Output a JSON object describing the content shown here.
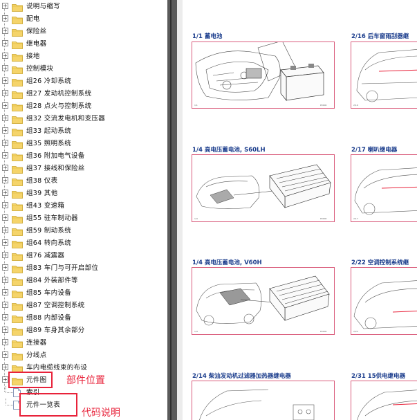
{
  "tree": {
    "items": [
      {
        "label": "说明与缩写",
        "expand": true
      },
      {
        "label": "配电",
        "expand": true
      },
      {
        "label": "保险丝",
        "expand": true
      },
      {
        "label": "继电器",
        "expand": true
      },
      {
        "label": "接地",
        "expand": true
      },
      {
        "label": "控制模块",
        "expand": true
      },
      {
        "label": "组26 冷却系统",
        "expand": true
      },
      {
        "label": "组27 发动机控制系统",
        "expand": true
      },
      {
        "label": "组28 点火与控制系统",
        "expand": true
      },
      {
        "label": "组32 交流发电机和变压器",
        "expand": true
      },
      {
        "label": "组33 起动系统",
        "expand": true
      },
      {
        "label": "组35 照明系统",
        "expand": true
      },
      {
        "label": "组36 附加电气设备",
        "expand": true
      },
      {
        "label": "组37 接线和保险丝",
        "expand": true
      },
      {
        "label": "组38 仪表",
        "expand": true
      },
      {
        "label": "组39 其他",
        "expand": true
      },
      {
        "label": "组43 变速箱",
        "expand": true
      },
      {
        "label": "组55 驻车制动器",
        "expand": true
      },
      {
        "label": "组59 制动系统",
        "expand": true
      },
      {
        "label": "组64 转向系统",
        "expand": true
      },
      {
        "label": "组76 减震器",
        "expand": true
      },
      {
        "label": "组83 车门与可开启部位",
        "expand": true
      },
      {
        "label": "组84 外装部件等",
        "expand": true
      },
      {
        "label": "组85 车内设备",
        "expand": true
      },
      {
        "label": "组87 空调控制系统",
        "expand": true
      },
      {
        "label": "组88 内部设备",
        "expand": true
      },
      {
        "label": "组89 车身其余部分",
        "expand": true
      },
      {
        "label": "连接器",
        "expand": true
      },
      {
        "label": "分线点",
        "expand": true
      },
      {
        "label": "车内电缆线束的布设",
        "expand": true
      }
    ],
    "selected_folder": "元件图",
    "doc_items": [
      "索引",
      "元件一览表"
    ]
  },
  "annotations": {
    "parts_location": "部件位置",
    "code_description": "代码说明"
  },
  "pdf": {
    "cards": [
      {
        "title": "1/1 蓄电池",
        "cap": "1/1",
        "cap2": "P0000"
      },
      {
        "title": "2/16 后车窗雨刮器继",
        "cap": "2/16",
        "cap2": ""
      },
      {
        "title": "1/4 高电压蓄电池, S60LH",
        "cap": "1/4",
        "cap2": "P0000"
      },
      {
        "title": "2/17 喇叭继电器",
        "cap": "2/17",
        "cap2": ""
      },
      {
        "title": "1/4 高电压蓄电池, V60H",
        "cap": "1/4",
        "cap2": "P0000"
      },
      {
        "title": "2/22 空调控制系统继",
        "cap": "2/22",
        "cap2": ""
      },
      {
        "title": "2/14 柴油发动机过滤器加热器继电器",
        "cap": "",
        "cap2": ""
      },
      {
        "title": "2/31 15供电继电器",
        "cap": "",
        "cap2": ""
      }
    ]
  },
  "colors": {
    "highlight": "#e8223a",
    "title_blue": "#1a3c8c",
    "card_border": "#d95a7a",
    "folder": "#f2c94c",
    "divider": "#5a5a5a"
  }
}
